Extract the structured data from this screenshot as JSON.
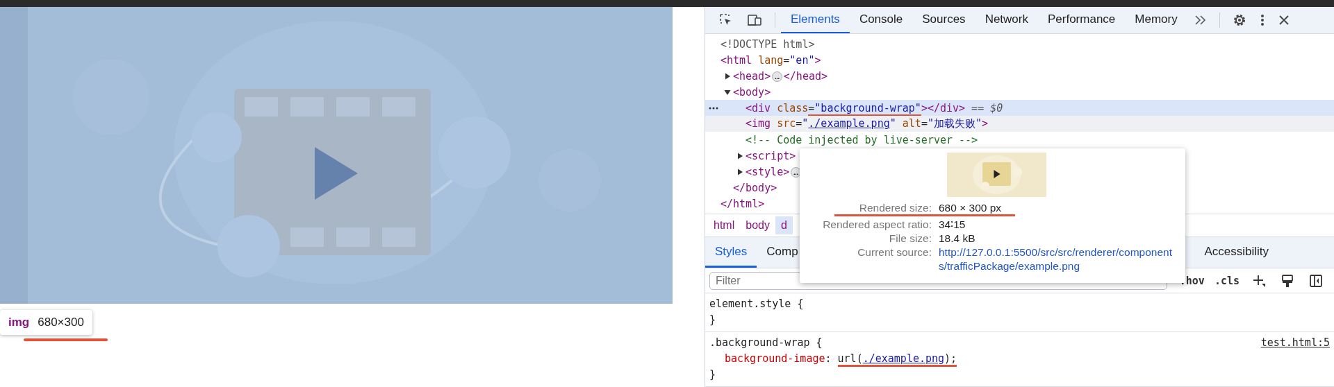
{
  "page": {
    "tooltip": {
      "tag": "img",
      "size": "680×300",
      "underlined": true
    }
  },
  "devtools": {
    "tabs": [
      {
        "label": "Elements",
        "selected": true
      },
      {
        "label": "Console",
        "selected": false
      },
      {
        "label": "Sources",
        "selected": false
      },
      {
        "label": "Network",
        "selected": false
      },
      {
        "label": "Performance",
        "selected": false
      },
      {
        "label": "Memory",
        "selected": false
      }
    ],
    "dom": [
      {
        "selected": false,
        "hovered": false,
        "tokens": [
          {
            "kind": "doctype",
            "text": "<!DOCTYPE html>"
          }
        ]
      },
      {
        "selected": false,
        "hovered": false,
        "tokens": [
          {
            "kind": "tag",
            "text": "<html"
          },
          {
            "kind": "attr",
            "text": " lang"
          },
          {
            "kind": "plain",
            "text": "="
          },
          {
            "kind": "value",
            "text": "\"en\""
          },
          {
            "kind": "tag",
            "text": ">"
          }
        ],
        "close": [
          {
            "kind": "tag",
            "text": "</html>"
          }
        ],
        "children": [
          {
            "selected": false,
            "hovered": false,
            "expanded": false,
            "tokens": [
              {
                "kind": "tag",
                "text": "<head>"
              },
              {
                "kind": "ellipsis",
                "text": "…"
              },
              {
                "kind": "tag",
                "text": "</head>"
              }
            ]
          },
          {
            "selected": false,
            "hovered": false,
            "expanded": true,
            "tokens": [
              {
                "kind": "tag",
                "text": "<body>"
              }
            ],
            "close": [
              {
                "kind": "tag",
                "text": "</body>"
              }
            ],
            "children": [
              {
                "selected": true,
                "hovered": false,
                "tokens": [
                  {
                    "kind": "tag",
                    "text": "<div"
                  },
                  {
                    "kind": "attr",
                    "text": " class"
                  },
                  {
                    "kind": "plain",
                    "text": "=",
                    "underlined": true
                  },
                  {
                    "kind": "value",
                    "text": "\"background-wrap\"",
                    "underlined": true
                  },
                  {
                    "kind": "tag",
                    "text": "></div>"
                  },
                  {
                    "kind": "note",
                    "text": " == $0"
                  }
                ]
              },
              {
                "selected": false,
                "hovered": true,
                "tokens": [
                  {
                    "kind": "tag",
                    "text": "<img"
                  },
                  {
                    "kind": "attr",
                    "text": " src"
                  },
                  {
                    "kind": "plain",
                    "text": "="
                  },
                  {
                    "kind": "value",
                    "text": "\""
                  },
                  {
                    "kind": "link",
                    "text": "./example.png"
                  },
                  {
                    "kind": "value",
                    "text": "\""
                  },
                  {
                    "kind": "attr",
                    "text": " alt"
                  },
                  {
                    "kind": "plain",
                    "text": "="
                  },
                  {
                    "kind": "value",
                    "text": "\"加载失败\""
                  },
                  {
                    "kind": "tag",
                    "text": ">"
                  }
                ]
              },
              {
                "selected": false,
                "hovered": false,
                "tokens": [
                  {
                    "kind": "comment",
                    "text": "<!-- Code injected by live-server -->"
                  }
                ]
              },
              {
                "selected": false,
                "hovered": false,
                "expanded": false,
                "tokens": [
                  {
                    "kind": "tag",
                    "text": "<script>"
                  }
                ]
              },
              {
                "selected": false,
                "hovered": false,
                "expanded": false,
                "tokens": [
                  {
                    "kind": "tag",
                    "text": "<style>"
                  },
                  {
                    "kind": "ellipsis",
                    "text": "…"
                  }
                ]
              }
            ]
          }
        ]
      }
    ],
    "popup": {
      "rows": [
        {
          "label": "Rendered size:",
          "value": "680 × 300 px",
          "kind": "text",
          "underlined": true
        },
        {
          "label": "Rendered aspect ratio:",
          "value": "34∶15",
          "kind": "text",
          "underlined": false
        },
        {
          "label": "File size:",
          "value": "18.4 kB",
          "kind": "text",
          "underlined": false
        },
        {
          "label": "Current source:",
          "value": "http://127.0.0.1:5500/src/src/renderer/components/trafficPackage/example.png",
          "kind": "link",
          "underlined": false
        }
      ]
    },
    "breadcrumbs": [
      {
        "label": "html",
        "selected": false
      },
      {
        "label": "body",
        "selected": false
      },
      {
        "label": "d",
        "selected": true
      }
    ],
    "style_tabs": [
      {
        "label": "Styles",
        "selected": true
      },
      {
        "label": "Comp",
        "selected": false
      },
      {
        "label": "Accessibility",
        "selected": false
      }
    ],
    "filter": {
      "placeholder": "Filter"
    },
    "toolbar": [
      ":hov",
      ".cls"
    ],
    "rules": [
      {
        "selector": "element.style {",
        "close": "}"
      },
      {
        "selector": ".background-wrap {",
        "source": "test.html:5",
        "close": "}",
        "properties": [
          {
            "name": "background-image",
            "sep": ": ",
            "underlined": true,
            "parts": [
              {
                "kind": "plain",
                "text": "url("
              },
              {
                "kind": "link",
                "text": "./example.png"
              },
              {
                "kind": "plain",
                "text": ");"
              }
            ]
          }
        ]
      }
    ]
  }
}
